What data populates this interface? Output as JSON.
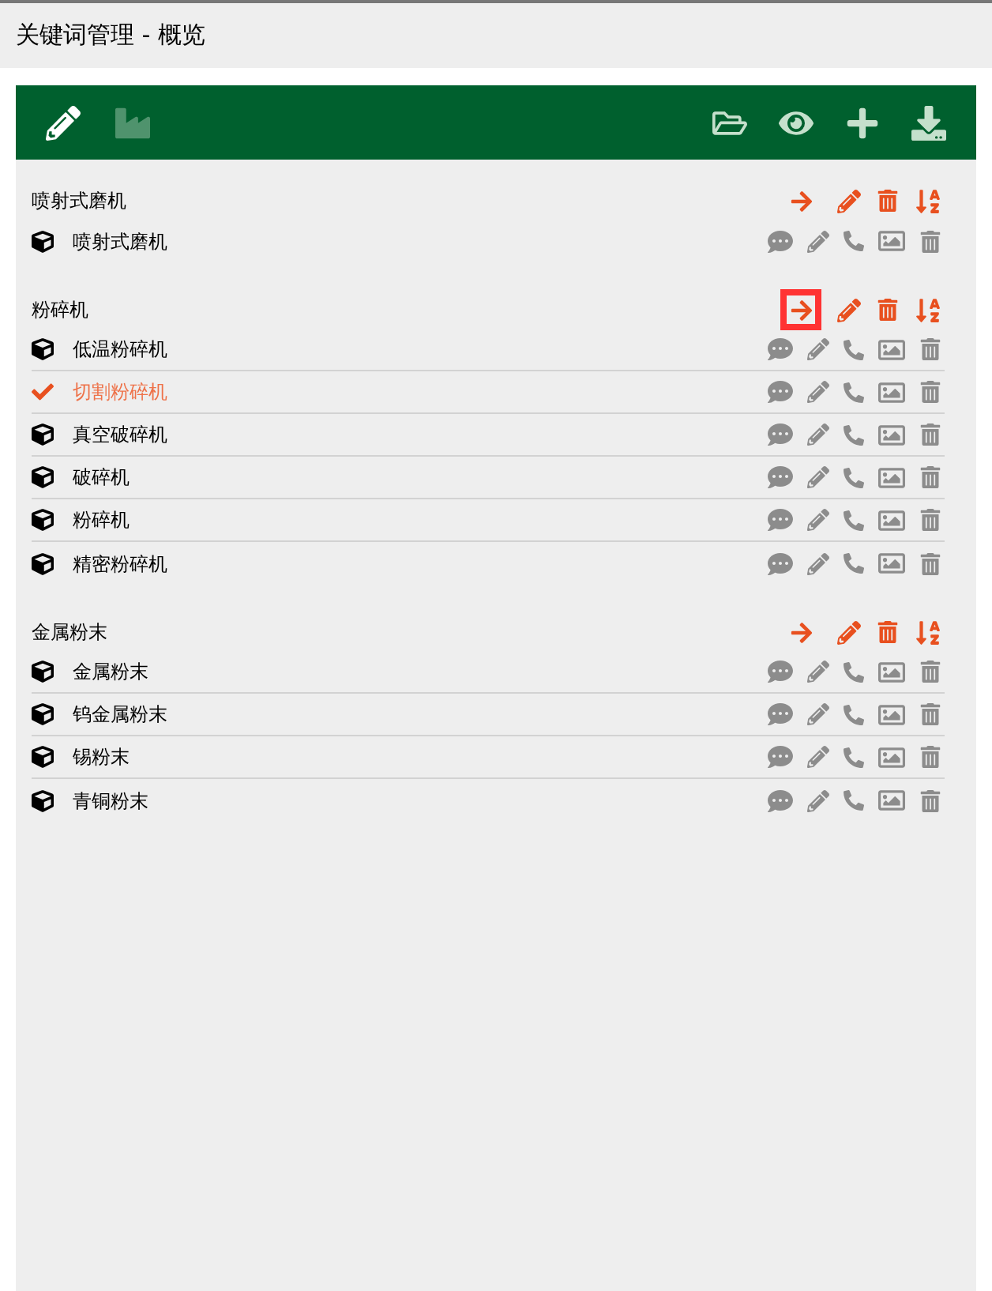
{
  "window": {
    "title": "关键词管理 - 概览"
  },
  "toolbar": [
    {
      "active": true,
      "disabled": false
    },
    {
      "active": false,
      "disabled": true
    },
    {
      "active": false,
      "disabled": false
    },
    {
      "active": false,
      "disabled": false
    },
    {
      "active": false,
      "disabled": false
    },
    {
      "active": false,
      "disabled": false
    }
  ],
  "groups": [
    {
      "title": "喷射式磨机",
      "highlighted": false,
      "items": [
        {
          "label": "喷射式磨机",
          "checked": false
        }
      ]
    },
    {
      "title": "粉碎机",
      "highlighted": true,
      "items": [
        {
          "label": "低温粉碎机",
          "checked": false
        },
        {
          "label": "切割粉碎机",
          "checked": true
        },
        {
          "label": "真空破碎机",
          "checked": false
        },
        {
          "label": "破碎机",
          "checked": false
        },
        {
          "label": "粉碎机",
          "checked": false
        },
        {
          "label": "精密粉碎机",
          "checked": false
        }
      ]
    },
    {
      "title": "金属粉末",
      "highlighted": false,
      "items": [
        {
          "label": "金属粉末",
          "checked": false
        },
        {
          "label": "钨金属粉末",
          "checked": false
        },
        {
          "label": "锡粉末",
          "checked": false
        },
        {
          "label": "青铜粉末",
          "checked": false
        }
      ]
    }
  ]
}
